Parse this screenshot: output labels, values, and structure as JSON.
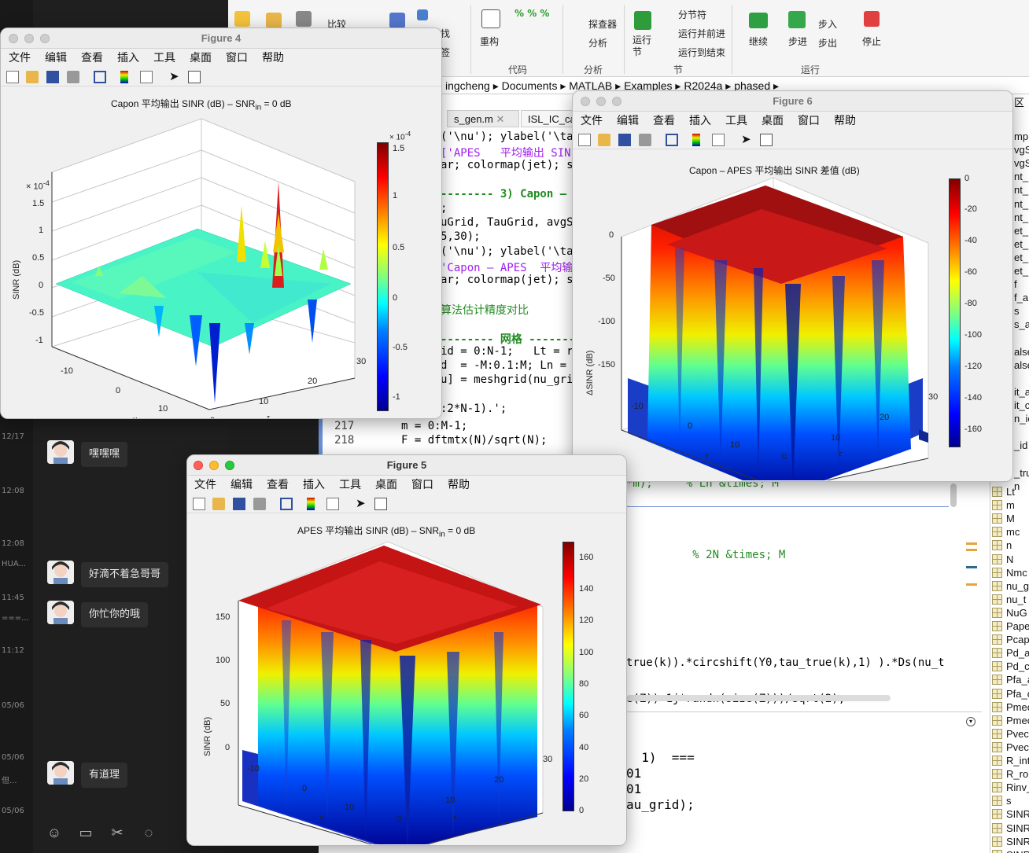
{
  "chat": {
    "times": [
      "12/17",
      "12:08",
      "12:08",
      "HUA...",
      "11:45",
      "===...",
      "11:12",
      "05/06",
      "05/06",
      "但...",
      "05/06"
    ],
    "messages": [
      "嘿嘿嘿",
      "好滴不着急哥哥",
      "你忙你的哦",
      "有道理"
    ]
  },
  "toolstrip": {
    "compare": "比较",
    "find": "找",
    "bookmark": "签",
    "refactor": "重构",
    "code_section": "代码",
    "inspector": "探查器",
    "analyze": "分析",
    "analyze_section": "分析",
    "run_section_btn": "运行\n节",
    "section_break": "分节符",
    "run_advance": "运行并前进",
    "run_to_end": "运行到结束",
    "section_section": "节",
    "continue": "继续",
    "step": "步进",
    "step_in": "步入",
    "step_out": "步出",
    "stop": "停止",
    "run_section": "运行"
  },
  "path": [
    "ingcheng",
    "Documents",
    "MATLAB",
    "Examples",
    "R2024a",
    "phased"
  ],
  "editor": {
    "tabs": [
      "s_gen.m",
      "ISL_IC_ca"
    ],
    "lines": [
      "('\\nu'); ylabel('\\ta",
      "['APES   平均输出 SIN",
      "ar; colormap(jet); s",
      "",
      "-------- 3) Capon – A",
      ";",
      "uGrid, TauGrid, avgS",
      "5,30);",
      "('\\nu'); ylabel('\\ta",
      "'Capon – APES  平均输",
      "ar; colormap(jet); s",
      "",
      "算法估计精度对比",
      "",
      "-------- 网格 -------",
      "id = 0:N-1;   Lt = r",
      "d  = -M:0.1:M; Ln =",
      "u] = meshgrid(nu_gri",
      "",
      ":2*N-1).';"
    ],
    "numbered_lines": [
      {
        "no": "217",
        "text": "m = 0:M-1;"
      },
      {
        "no": "218",
        "text": "F = dftmtx(N)/sqrt(N);"
      }
    ],
    "right_lines": [
      "*m);     % Ln &times; M",
      "",
      "",
      "",
      "          % 2N &times; M",
      "",
      "",
      "",
      "",
      "",
      "true(k)).*circshift(Y0,tau_true(k),1) ).*Ds(nu_t",
      "",
      "e(Z))+1j*randn(size(Z)))/sqrt(2);"
    ]
  },
  "command": [
    "  1)  ===",
    "01",
    "01",
    "au_grid);"
  ],
  "workspace": {
    "header": "区",
    "top_items": [
      "mp",
      "vgS",
      "vgS",
      "nt_",
      "nt_",
      "nt_",
      "nt_",
      "et_",
      "et_",
      "et_",
      "et_",
      "f",
      "f_a",
      "s",
      "s_a",
      "",
      "alse",
      "alse",
      "",
      "it_a",
      "it_c",
      "n_ic",
      "",
      "_id",
      "",
      "_tru",
      "n"
    ],
    "items": [
      "Lt",
      "m",
      "M",
      "mc",
      "n",
      "N",
      "Nmc",
      "nu_g",
      "nu_t",
      "NuG",
      "Pape",
      "Pcap",
      "Pd_a",
      "Pd_c",
      "Pfa_a",
      "Pfa_c",
      "Pmec",
      "Pmec",
      "Pvec",
      "Pvec",
      "R_int",
      "R_ro",
      "Rinv_",
      "s",
      "SINR",
      "SINR",
      "SINR",
      "SINR"
    ]
  },
  "figure_menu": [
    "文件",
    "编辑",
    "查看",
    "插入",
    "工具",
    "桌面",
    "窗口",
    "帮助"
  ],
  "figures": {
    "fig4": {
      "window_title": "Figure 4",
      "title_main": "Capon  平均输出 SINR (dB) – SNR",
      "title_sub": "in",
      "title_tail": " = 0 dB",
      "zlabel": "SINR (dB)",
      "xlabel": "ν",
      "ylabel": "τ",
      "exponent": "× 10",
      "exponent_pow": "-4",
      "cbar_exponent": "× 10",
      "cbar_exponent_pow": "-4",
      "zticks": [
        "1.5",
        "1",
        "0.5",
        "0",
        "-0.5",
        "-1"
      ],
      "nu_ticks": [
        "-10",
        "0",
        "10"
      ],
      "tau_ticks": [
        "0",
        "10",
        "20",
        "30"
      ],
      "cbar_ticks": [
        "1.5",
        "1",
        "0.5",
        "0",
        "-0.5",
        "-1"
      ]
    },
    "fig5": {
      "window_title": "Figure 5",
      "title_main": "APES   平均输出 SINR (dB) – SNR",
      "title_sub": "in",
      "title_tail": " = 0 dB",
      "zlabel": "SINR (dB)",
      "xlabel": "ν",
      "ylabel": "τ",
      "zticks": [
        "150",
        "100",
        "50",
        "0"
      ],
      "nu_ticks": [
        "-10",
        "0",
        "10"
      ],
      "tau_ticks": [
        "0",
        "10",
        "20",
        "30"
      ],
      "cbar_ticks": [
        "160",
        "140",
        "120",
        "100",
        "80",
        "60",
        "40",
        "20",
        "0"
      ]
    },
    "fig6": {
      "window_title": "Figure 6",
      "title": "Capon – APES  平均输出 SINR 差值 (dB)",
      "zlabel": "ΔSINR (dB)",
      "xlabel": "ν",
      "ylabel": "τ",
      "zticks": [
        "0",
        "-50",
        "-100",
        "-150"
      ],
      "nu_ticks": [
        "-10",
        "0",
        "10"
      ],
      "tau_ticks": [
        "0",
        "10",
        "20",
        "30"
      ],
      "cbar_ticks": [
        "0",
        "-20",
        "-40",
        "-60",
        "-80",
        "-100",
        "-120",
        "-140",
        "-160"
      ]
    }
  },
  "colors": {
    "chat_bg": "#1f1f1f",
    "bubble": "#2e2e2e",
    "code_comment": "#228b22",
    "code_string": "#a020f0",
    "code_keyword": "#0000ff"
  }
}
